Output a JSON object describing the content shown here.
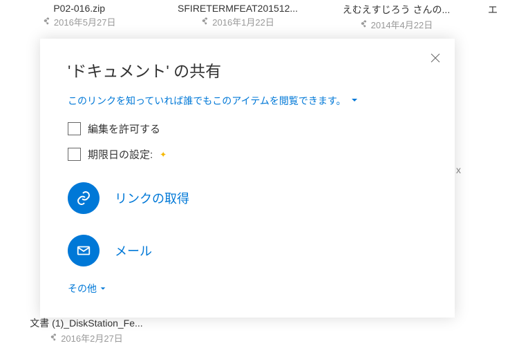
{
  "files": {
    "top": [
      {
        "name": "P02-016.zip",
        "date": "2016年5月27日"
      },
      {
        "name": "SFIRETERMFEAT201512...",
        "date": "2016年1月22日"
      },
      {
        "name": "えむえすじろう さんの...",
        "date": "2014年4月22日"
      },
      {
        "name": "エ",
        "date": ""
      }
    ],
    "bottom": {
      "name": "文書 (1)_DiskStation_Fe...",
      "date": "2016年2月27日"
    }
  },
  "dialog": {
    "title": "'ドキュメント' の共有",
    "link_info": "このリンクを知っていれば誰でもこのアイテムを閲覧できます。",
    "allow_edit": "編集を許可する",
    "expiry": "期限日の設定:",
    "get_link": "リンクの取得",
    "mail": "メール",
    "other": "その他"
  }
}
